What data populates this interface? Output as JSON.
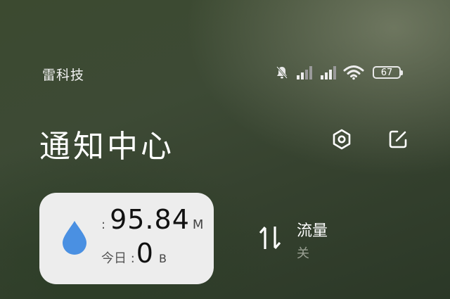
{
  "status_bar": {
    "carrier": "雷科技",
    "battery_level": "67",
    "icons": [
      "bell-muted-icon",
      "signal-icon",
      "signal-icon",
      "wifi-icon",
      "battery-icon"
    ]
  },
  "header": {
    "title": "通知中心",
    "actions": [
      "settings-icon",
      "edit-icon"
    ]
  },
  "data_card": {
    "usage_prefix": ":",
    "usage_value": "95.84",
    "usage_unit": "M",
    "today_label": "今日 :",
    "today_value": "0",
    "today_unit": "B",
    "icon": "water-drop-icon",
    "accent_color": "#4a90e2"
  },
  "mobile_data_tile": {
    "title": "流量",
    "status": "关",
    "icon": "data-arrows-icon"
  }
}
